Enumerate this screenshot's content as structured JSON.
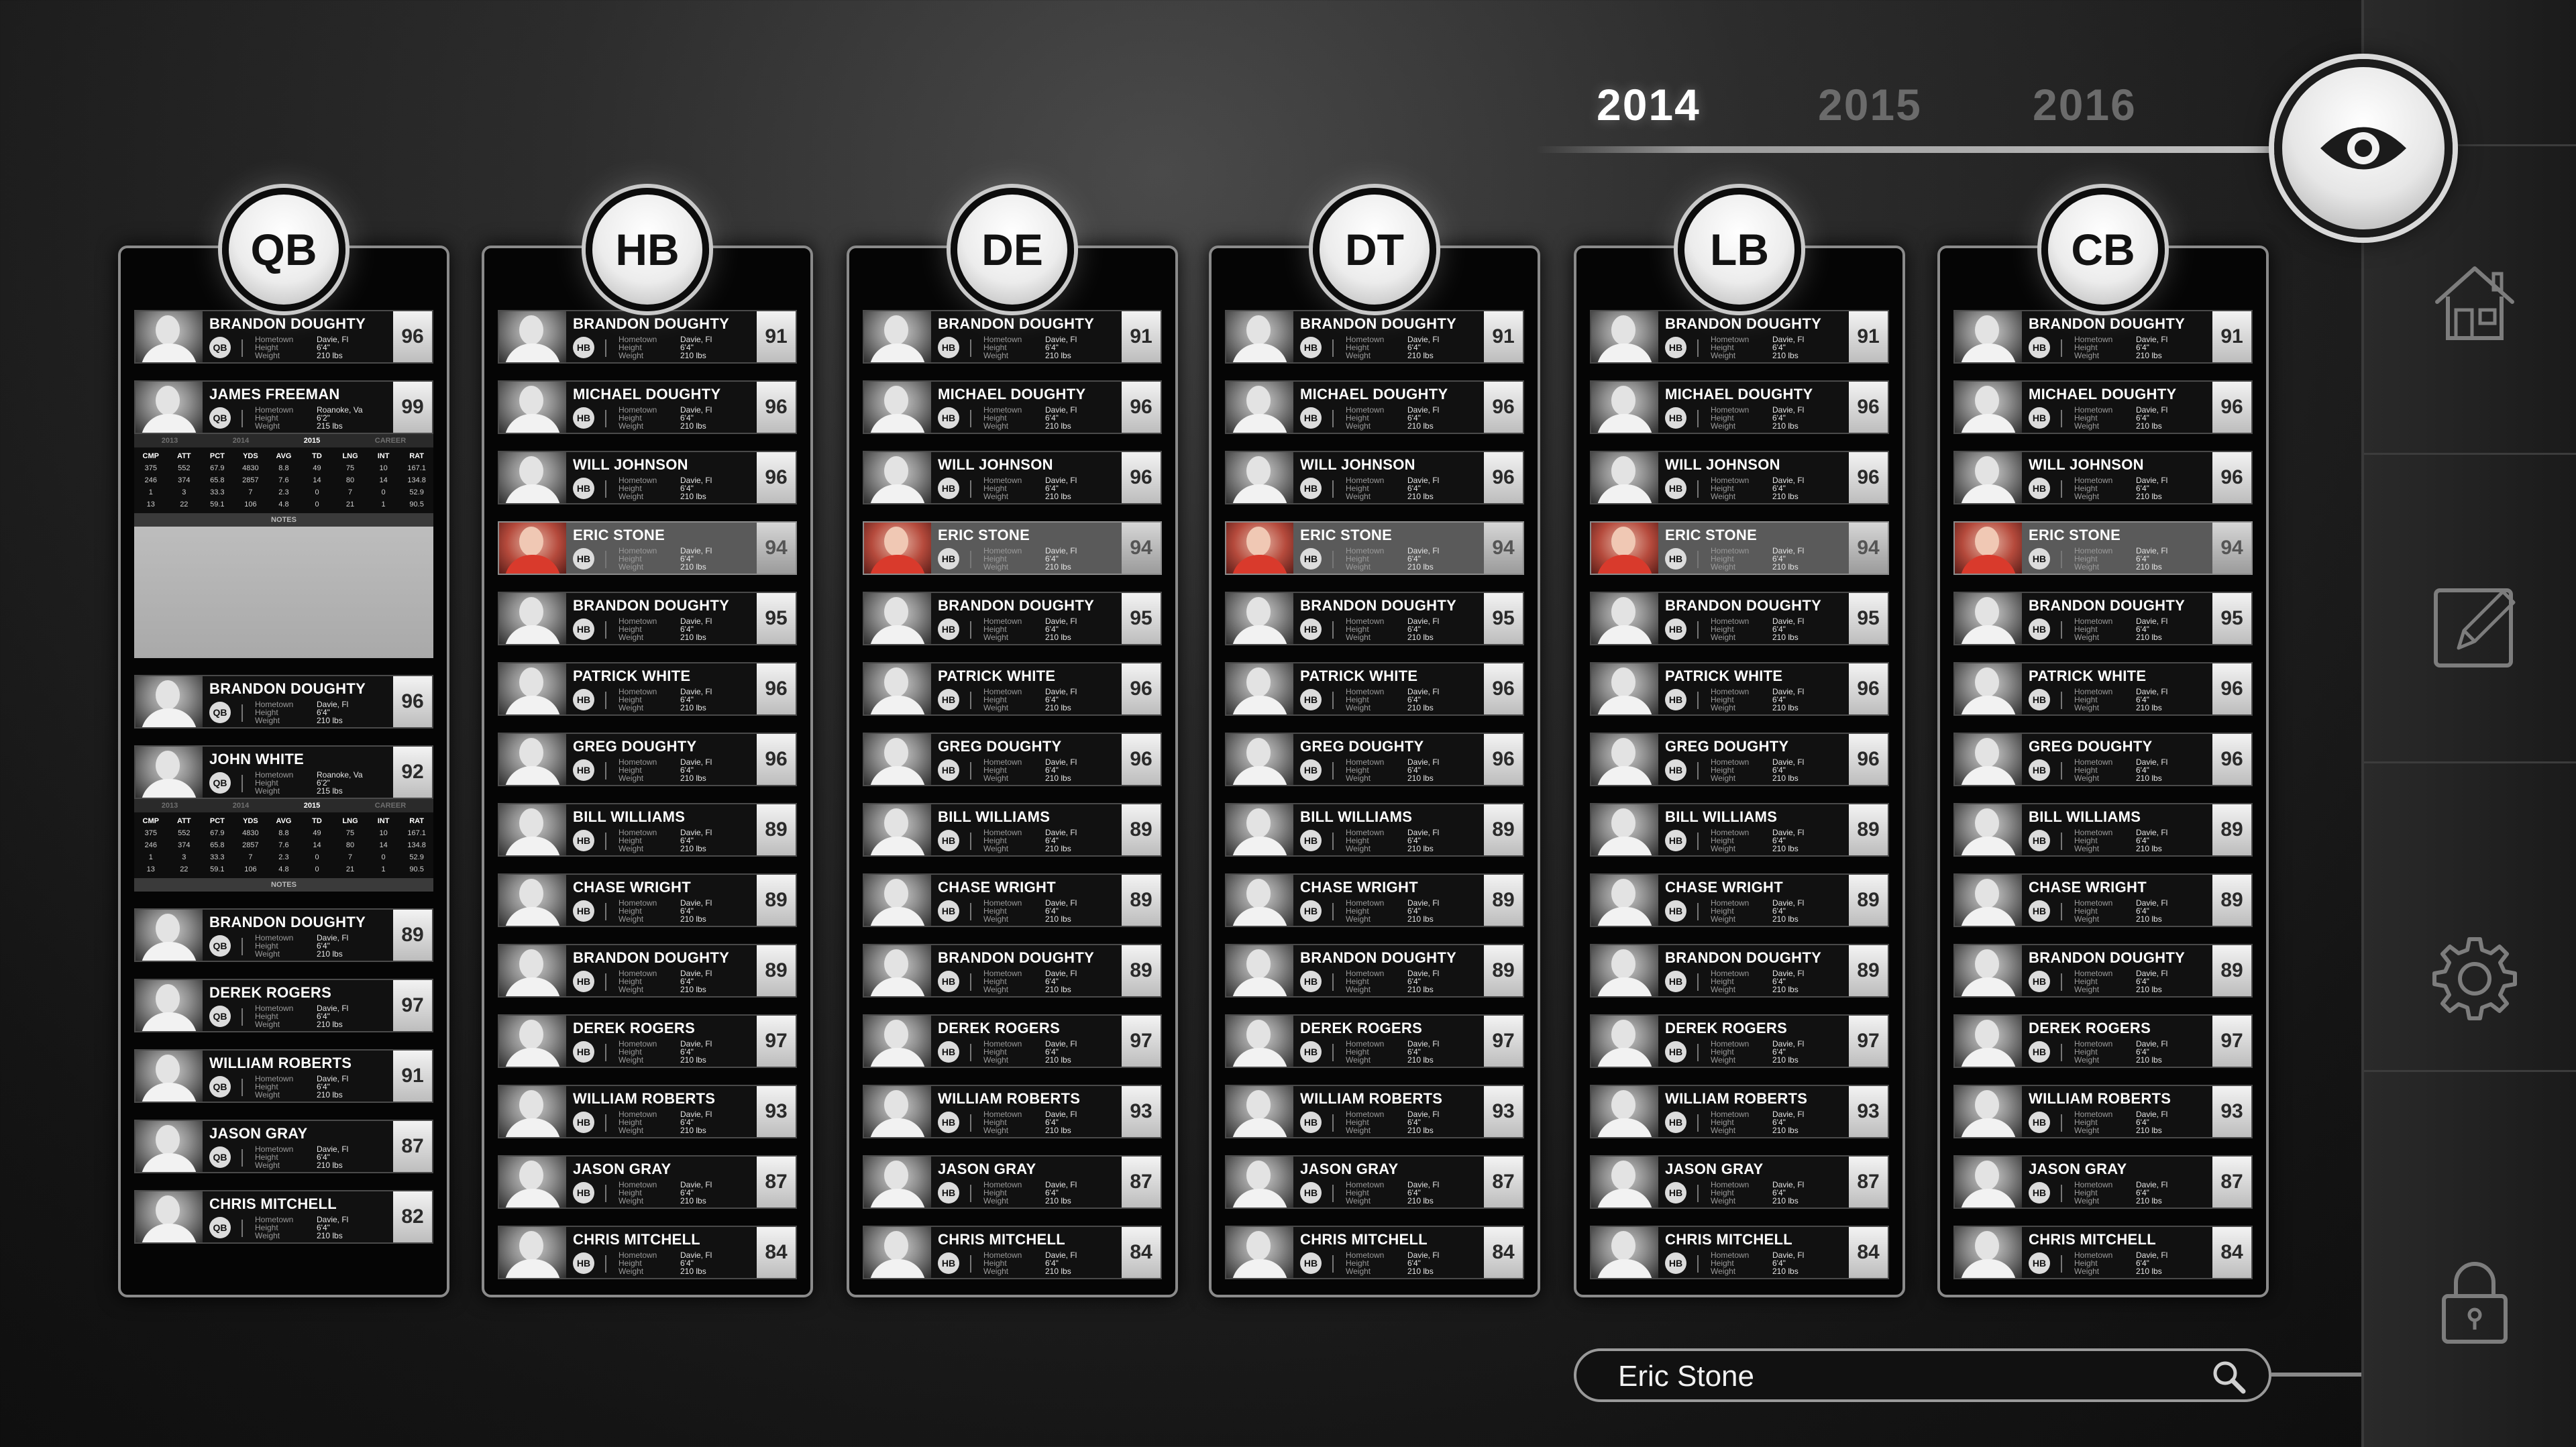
{
  "years": [
    {
      "label": "2014",
      "active": true
    },
    {
      "label": "2015",
      "active": false
    },
    {
      "label": "2016",
      "active": false
    }
  ],
  "icons": {
    "eye": "eye-icon",
    "home": "home-icon",
    "edit": "edit-icon",
    "settings": "gear-icon",
    "lock": "lock-icon",
    "search": "search-icon"
  },
  "colors": {
    "accent": "#ffffff",
    "inactive_year": "#6b6b6b",
    "highlight_row": "#5a5a5a",
    "photo_red": "#d93a2c"
  },
  "meta_labels": [
    "Hometown",
    "Height",
    "Weight"
  ],
  "stats_header": [
    "CMP",
    "ATT",
    "PCT",
    "YDS",
    "AVG",
    "TD",
    "LNG",
    "INT",
    "RAT"
  ],
  "stats_rows": [
    [
      "375",
      "552",
      "67.9",
      "4830",
      "8.8",
      "49",
      "75",
      "10",
      "167.1"
    ],
    [
      "246",
      "374",
      "65.8",
      "2857",
      "7.6",
      "14",
      "80",
      "14",
      "134.8"
    ],
    [
      "1",
      "3",
      "33.3",
      "7",
      "2.3",
      "0",
      "7",
      "0",
      "52.9"
    ],
    [
      "13",
      "22",
      "59.1",
      "106",
      "4.8",
      "0",
      "21",
      "1",
      "90.5"
    ]
  ],
  "stats_tabs": [
    "2013",
    "2014",
    "2015",
    "CAREER"
  ],
  "notes_label": "NOTES",
  "columns": [
    {
      "position": "QB",
      "players": [
        {
          "name": "BRANDON DOUGHTY",
          "pos": "QB",
          "hometown": "Davie, Fl",
          "height": "6'4\"",
          "weight": "210 lbs",
          "rating": "96"
        },
        {
          "name": "JAMES FREEMAN",
          "pos": "QB",
          "hometown": "Roanoke, Va",
          "height": "6'2\"",
          "weight": "215 lbs",
          "rating": "99",
          "expanded": true,
          "notes_open": true
        },
        {
          "name": "BRANDON DOUGHTY",
          "pos": "QB",
          "hometown": "Davie, Fl",
          "height": "6'4\"",
          "weight": "210 lbs",
          "rating": "96"
        },
        {
          "name": "JOHN WHITE",
          "pos": "QB",
          "hometown": "Roanoke, Va",
          "height": "6'2\"",
          "weight": "215 lbs",
          "rating": "92",
          "expanded": true,
          "notes_open": false
        },
        {
          "name": "BRANDON DOUGHTY",
          "pos": "QB",
          "hometown": "Davie, Fl",
          "height": "6'4\"",
          "weight": "210 lbs",
          "rating": "89"
        },
        {
          "name": "DEREK ROGERS",
          "pos": "QB",
          "hometown": "Davie, Fl",
          "height": "6'4\"",
          "weight": "210 lbs",
          "rating": "97"
        },
        {
          "name": "WILLIAM ROBERTS",
          "pos": "QB",
          "hometown": "Davie, Fl",
          "height": "6'4\"",
          "weight": "210 lbs",
          "rating": "91"
        },
        {
          "name": "JASON GRAY",
          "pos": "QB",
          "hometown": "Davie, Fl",
          "height": "6'4\"",
          "weight": "210 lbs",
          "rating": "87"
        },
        {
          "name": "CHRIS MITCHELL",
          "pos": "QB",
          "hometown": "Davie, Fl",
          "height": "6'4\"",
          "weight": "210 lbs",
          "rating": "82"
        }
      ]
    },
    {
      "position": "HB",
      "players": []
    },
    {
      "position": "DE",
      "players": []
    },
    {
      "position": "DT",
      "players": []
    },
    {
      "position": "LB",
      "players": []
    },
    {
      "position": "CB",
      "players": []
    }
  ],
  "hb_roster": [
    {
      "name": "BRANDON DOUGHTY",
      "rating": "91"
    },
    {
      "name": "MICHAEL DOUGHTY",
      "rating": "96"
    },
    {
      "name": "WILL JOHNSON",
      "rating": "96"
    },
    {
      "name": "ERIC STONE",
      "rating": "94",
      "highlight": true,
      "red": true
    },
    {
      "name": "BRANDON DOUGHTY",
      "rating": "95"
    },
    {
      "name": "PATRICK WHITE",
      "rating": "96"
    },
    {
      "name": "GREG DOUGHTY",
      "rating": "96"
    },
    {
      "name": "BILL WILLIAMS",
      "rating": "89"
    },
    {
      "name": "CHASE WRIGHT",
      "rating": "89"
    },
    {
      "name": "BRANDON DOUGHTY",
      "rating": "89"
    },
    {
      "name": "DEREK ROGERS",
      "rating": "97"
    },
    {
      "name": "WILLIAM ROBERTS",
      "rating": "93"
    },
    {
      "name": "JASON GRAY",
      "rating": "87"
    },
    {
      "name": "CHRIS MITCHELL",
      "rating": "84"
    }
  ],
  "default_meta": {
    "pos": "HB",
    "hometown": "Davie, Fl",
    "height": "6'4\"",
    "weight": "210 lbs"
  },
  "search": {
    "value": "Eric Stone",
    "placeholder": ""
  }
}
